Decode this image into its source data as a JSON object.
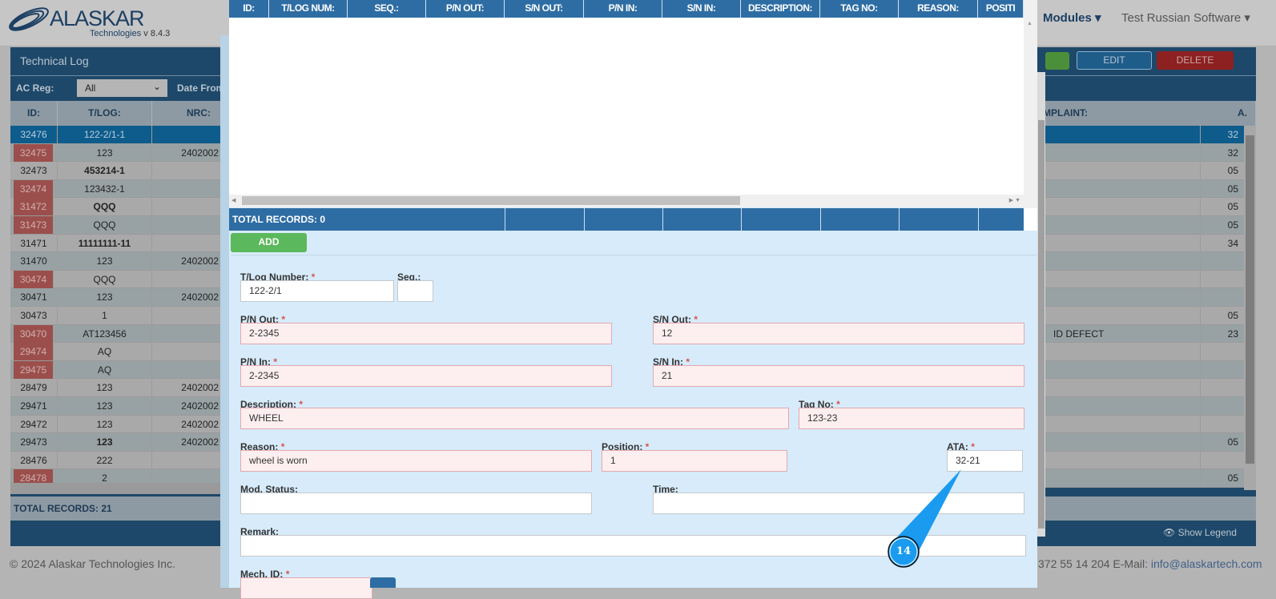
{
  "header": {
    "logo": "ALASKAR",
    "logo_sub": "Technologies",
    "version": "v 8.4.3",
    "nav_modules": "Modules ▾",
    "nav_user": "Test Russian Software ▾"
  },
  "panel": {
    "title": "Technical Log",
    "ac_reg_label": "AC Reg:",
    "ac_reg_value": "All",
    "date_from_label": "Date From",
    "edit_label": "EDIT",
    "delete_label": "DELETE",
    "show_legend": "Show Legend",
    "total": "TOTAL RECORDS: 21"
  },
  "table": {
    "headers": [
      "ID:",
      "T/LOG:",
      "NRC:",
      "MPLAINT:",
      "A."
    ],
    "rows": [
      {
        "id": "32476",
        "tlog": "122-2/1-1",
        "nrc": "",
        "comp": "",
        "a": "32",
        "sel": true
      },
      {
        "id": "32475",
        "tlog": "123",
        "nrc": "2402002",
        "comp": "",
        "a": "32",
        "red": true
      },
      {
        "id": "32473",
        "tlog": "453214-1",
        "nrc": "",
        "comp": "",
        "a": "05",
        "bold": true
      },
      {
        "id": "32474",
        "tlog": "123432-1",
        "nrc": "",
        "comp": "",
        "a": "05",
        "red": true
      },
      {
        "id": "31472",
        "tlog": "QQQ",
        "nrc": "",
        "comp": "",
        "a": "05",
        "red": true,
        "bold": true
      },
      {
        "id": "31473",
        "tlog": "QQQ",
        "nrc": "",
        "comp": "",
        "a": "05",
        "red": true
      },
      {
        "id": "31471",
        "tlog": "11111111-11",
        "nrc": "",
        "comp": "",
        "a": "34",
        "bold": true
      },
      {
        "id": "31470",
        "tlog": "123",
        "nrc": "2402002",
        "comp": "",
        "a": ""
      },
      {
        "id": "30474",
        "tlog": "QQQ",
        "nrc": "",
        "comp": "",
        "a": "",
        "red": true
      },
      {
        "id": "30471",
        "tlog": "123",
        "nrc": "2402002",
        "comp": "",
        "a": ""
      },
      {
        "id": "30473",
        "tlog": "1",
        "nrc": "",
        "comp": "",
        "a": "05"
      },
      {
        "id": "30470",
        "tlog": "AT123456",
        "nrc": "",
        "comp": "ID DEFECT",
        "a": "23",
        "red": true
      },
      {
        "id": "29474",
        "tlog": "AQ",
        "nrc": "",
        "comp": "",
        "a": "",
        "red": true
      },
      {
        "id": "29475",
        "tlog": "AQ",
        "nrc": "",
        "comp": "",
        "a": "",
        "red": true
      },
      {
        "id": "28479",
        "tlog": "123",
        "nrc": "2402002",
        "comp": "",
        "a": ""
      },
      {
        "id": "29471",
        "tlog": "123",
        "nrc": "2402002",
        "comp": "",
        "a": ""
      },
      {
        "id": "29472",
        "tlog": "123",
        "nrc": "2402002",
        "comp": "",
        "a": ""
      },
      {
        "id": "29473",
        "tlog": "123",
        "nrc": "2402002",
        "comp": "",
        "a": "05",
        "bold": true
      },
      {
        "id": "28476",
        "tlog": "222",
        "nrc": "",
        "comp": "",
        "a": ""
      },
      {
        "id": "28478",
        "tlog": "2",
        "nrc": "",
        "comp": "",
        "a": "05",
        "red": true
      }
    ]
  },
  "footer": {
    "copyright": "© 2024 Alaskar Technologies Inc.",
    "contact": "372 55 14 204 E-Mail: ",
    "email": "info@alaskartech.com"
  },
  "modal": {
    "grid_headers": [
      "ID:",
      "T/LOG NUM:",
      "SEQ.:",
      "P/N OUT:",
      "S/N OUT:",
      "P/N IN:",
      "S/N IN:",
      "DESCRIPTION:",
      "TAG NO:",
      "REASON:",
      "POSITI"
    ],
    "total": "TOTAL RECORDS: 0",
    "add_label": "ADD",
    "form": {
      "tlog": {
        "label": "T/Log Number:",
        "value": "122-2/1"
      },
      "seq": {
        "label": "Seq.:",
        "value": ""
      },
      "pn_out": {
        "label": "P/N Out:",
        "value": "2-2345"
      },
      "sn_out": {
        "label": "S/N Out:",
        "value": "12"
      },
      "pn_in": {
        "label": "P/N In:",
        "value": "2-2345"
      },
      "sn_in": {
        "label": "S/N In:",
        "value": "21"
      },
      "description": {
        "label": "Description:",
        "value": "WHEEL"
      },
      "tag_no": {
        "label": "Tag No:",
        "value": "123-23"
      },
      "reason": {
        "label": "Reason:",
        "value": "wheel is worn"
      },
      "position": {
        "label": "Position:",
        "value": "1"
      },
      "ata": {
        "label": "ATA:",
        "value": "32-21"
      },
      "mod_status": {
        "label": "Mod. Status:",
        "value": ""
      },
      "time": {
        "label": "Time:",
        "value": ""
      },
      "remark": {
        "label": "Remark:",
        "value": ""
      },
      "mech_id": {
        "label": "Mech. ID:"
      },
      "required_mark": "*"
    }
  },
  "callout": {
    "number": "14",
    "color": "#1a9bf0"
  }
}
